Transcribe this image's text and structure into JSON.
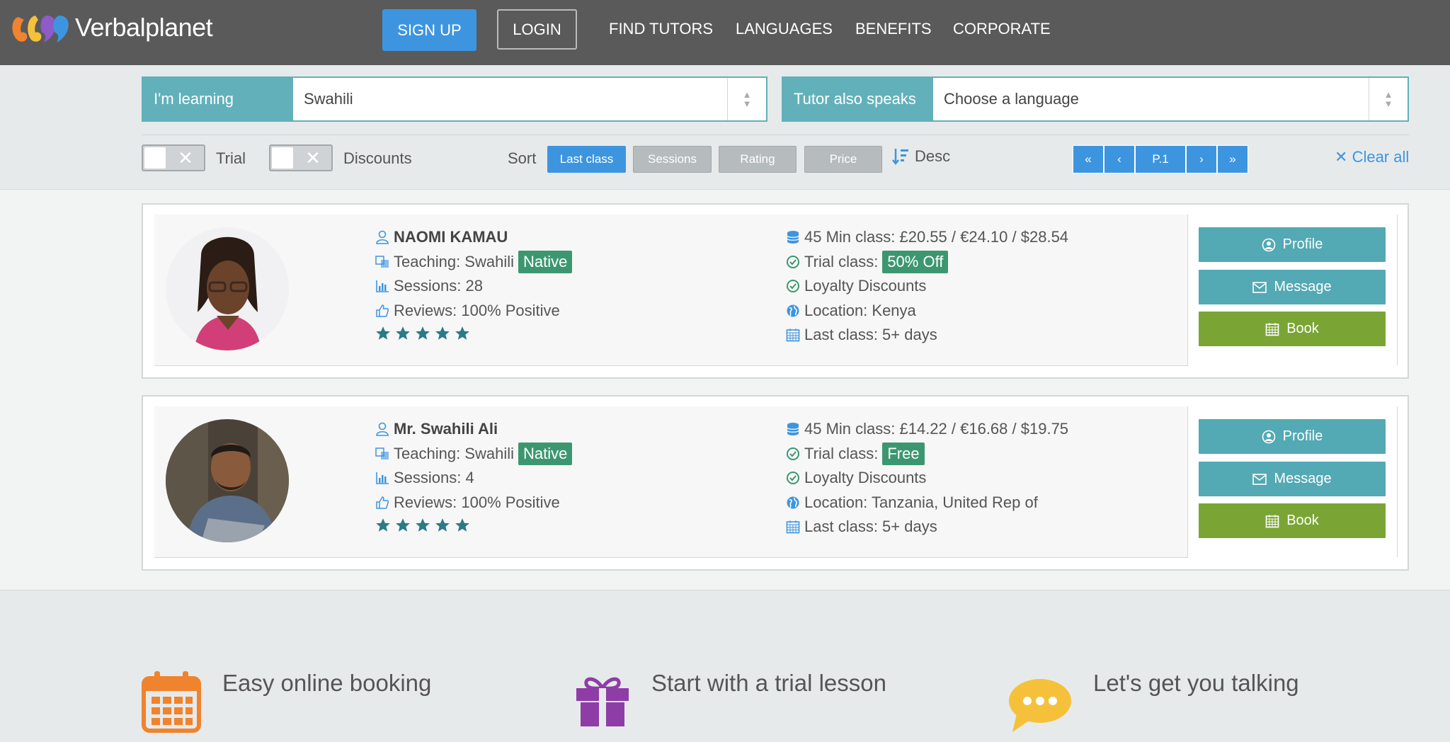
{
  "nav": {
    "logo_text": "Verbalplanet",
    "signup": "SIGN UP",
    "login": "LOGIN",
    "links": [
      "FIND TUTORS",
      "LANGUAGES",
      "BENEFITS",
      "CORPORATE"
    ]
  },
  "filters": {
    "learning_label": "I'm learning",
    "learning_value": "Swahili",
    "speaks_label": "Tutor also speaks",
    "speaks_value": "Choose a language",
    "trial_label": "Trial",
    "discounts_label": "Discounts",
    "sort_label": "Sort",
    "sort_options": [
      "Last class",
      "Sessions",
      "Rating",
      "Price"
    ],
    "sort_active": "Last class",
    "order": "Desc",
    "page": "P.1",
    "clear_all": "Clear all"
  },
  "tutors": [
    {
      "name": "NAOMI KAMAU",
      "teaching": "Teaching: Swahili",
      "native_badge": "Native",
      "sessions": "Sessions: 28",
      "reviews": "Reviews: 100% Positive",
      "rating": 5,
      "price": "45 Min class: £20.55 / €24.10 / $28.54",
      "trial_label": "Trial class:",
      "trial_badge": "50% Off",
      "loyalty": "Loyalty Discounts",
      "location": "Location: Kenya",
      "last_class": "Last class: 5+ days"
    },
    {
      "name": "Mr. Swahili Ali",
      "teaching": "Teaching: Swahili",
      "native_badge": "Native",
      "sessions": "Sessions: 4",
      "reviews": "Reviews: 100% Positive",
      "rating": 5,
      "price": "45 Min class: £14.22 / €16.68 / $19.75",
      "trial_label": "Trial class:",
      "trial_badge": "Free",
      "loyalty": "Loyalty Discounts",
      "location": "Location: Tanzania, United Rep of",
      "last_class": "Last class: 5+ days"
    }
  ],
  "actions": {
    "profile": "Profile",
    "message": "Message",
    "book": "Book"
  },
  "features": [
    {
      "title": "Easy online booking",
      "icon": "calendar-icon"
    },
    {
      "title": "Start with a trial lesson",
      "icon": "gift-icon"
    },
    {
      "title": "Let's get you talking",
      "icon": "chat-bubble-icon"
    }
  ],
  "colors": {
    "nav_bg": "#5a5a5a",
    "primary_blue": "#3d95e0",
    "teal": "#53a9b4",
    "green": "#7aa535",
    "badge_green": "#3c9770"
  }
}
